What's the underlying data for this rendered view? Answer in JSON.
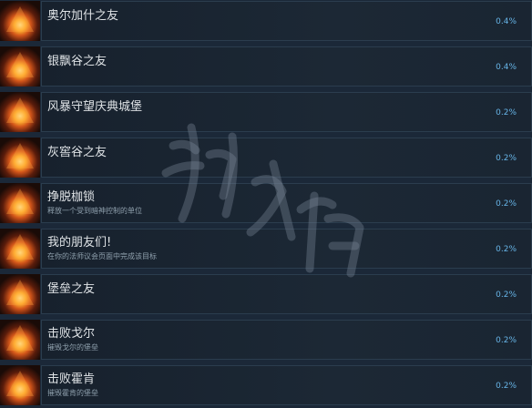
{
  "achievements": [
    {
      "title": "奥尔加什之友",
      "desc": "",
      "pct": "0.4%"
    },
    {
      "title": "银飘谷之友",
      "desc": "",
      "pct": "0.4%"
    },
    {
      "title": "风暴守望庆典城堡",
      "desc": "",
      "pct": "0.2%"
    },
    {
      "title": "灰窖谷之友",
      "desc": "",
      "pct": "0.2%"
    },
    {
      "title": "挣脱枷锁",
      "desc": "释放一个受到暗神控制的单位",
      "pct": "0.2%"
    },
    {
      "title": "我的朋友们!",
      "desc": "在你的法师议会页面中完成该目标",
      "pct": "0.2%"
    },
    {
      "title": "堡垒之友",
      "desc": "",
      "pct": "0.2%"
    },
    {
      "title": "击败戈尔",
      "desc": "摧毁戈尔的堡垒",
      "pct": "0.2%"
    },
    {
      "title": "击败霍肯",
      "desc": "摧毁霍肯的堡垒",
      "pct": "0.2%"
    }
  ],
  "icon": "fire-pyramid-icon",
  "colors": {
    "background": "#1b2838",
    "percent": "#66b4e6",
    "title": "#dfe3e6",
    "desc": "#8fa0ad"
  }
}
